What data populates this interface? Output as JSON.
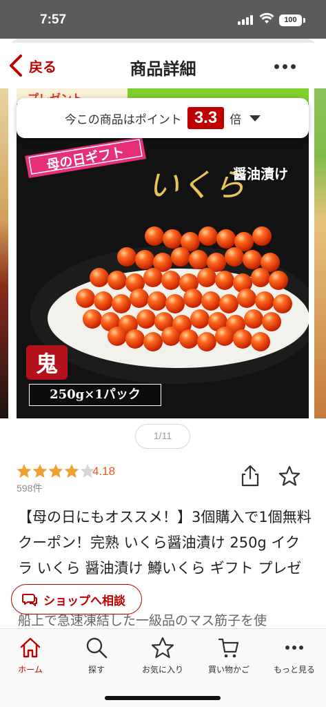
{
  "status_bar": {
    "time": "7:57",
    "battery": "100"
  },
  "header": {
    "back_label": "戻る",
    "title": "商品詳細"
  },
  "banner": {
    "promo_text": "プレゼント"
  },
  "points": {
    "prefix": "今この商品はポイント",
    "multiplier": "3.3",
    "suffix": "倍"
  },
  "image": {
    "ribbon_text": "母の日ギフト",
    "product_name": "いくら",
    "product_sub": "醤油漬け",
    "seal_text": "鬼",
    "weight": "250g×1パック"
  },
  "pager": {
    "label": "1/11"
  },
  "rating": {
    "value": "4.18",
    "stars": 4.2,
    "reviews": "598件"
  },
  "product": {
    "title": "【母の日にもオススメ！】3個購入で1個無料クーポン！完熟 いくら醤油漬け 250g イクラ いくら 醤油漬け  鱒いくら ギフト プレゼント 冷凍",
    "description": "船上で急速凍結した一級品のマス筋子を使"
  },
  "consult_button": {
    "label": "ショップへ相談"
  },
  "tabs": [
    {
      "label": "ホーム",
      "icon": "home-icon",
      "active": true
    },
    {
      "label": "探す",
      "icon": "search-icon",
      "active": false
    },
    {
      "label": "お気に入り",
      "icon": "star-icon",
      "active": false
    },
    {
      "label": "買い物かご",
      "icon": "cart-icon",
      "active": false
    },
    {
      "label": "もっと見る",
      "icon": "more-icon",
      "active": false
    }
  ],
  "colors": {
    "accent": "#bf0000",
    "rating": "#e45b1d",
    "star": "#f0a030"
  }
}
